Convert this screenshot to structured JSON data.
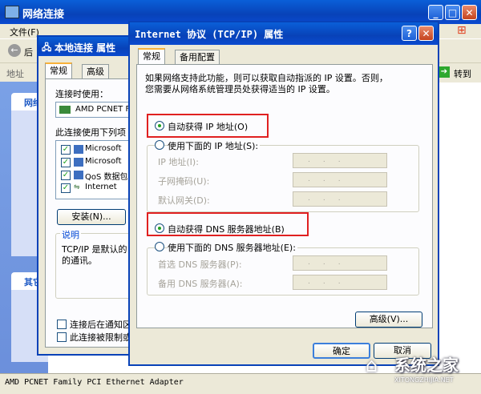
{
  "bg_window": {
    "title": "网络连接",
    "menu": [
      "文件(F)"
    ],
    "back_label": "后",
    "address_label": "地址",
    "go_label": "转到",
    "sidebar_head1": "网络",
    "sidebar_head2": "其它"
  },
  "local_dialog": {
    "title": "本地连接 属性",
    "tabs": [
      "常规",
      "高级"
    ],
    "connect_using": "连接时使用：",
    "adapter_short": "AMD PCNET F",
    "items_label": "此连接使用下列项",
    "items": [
      "Microsoft",
      "Microsoft",
      "QoS 数据包",
      "Internet"
    ],
    "install_button": "安装(N)...",
    "desc_group": "说明",
    "desc_text": "TCP/IP 是默认的广域网协议，它提供在不同的相互连接的网络上的通讯。",
    "desc_line1": "TCP/IP 是默认的",
    "desc_line2": "的通讯。",
    "chk1": "连接后在通知区",
    "chk2": "此连接被限制或"
  },
  "tcp_dialog": {
    "title": "Internet 协议 (TCP/IP) 属性",
    "tabs": [
      "常规",
      "备用配置"
    ],
    "intro1": "如果网络支持此功能，则可以获取自动指派的 IP 设置。否则，",
    "intro2": "您需要从网络系统管理员处获得适当的 IP 设置。",
    "auto_ip": "自动获得 IP 地址(O)",
    "manual_ip": "使用下面的 IP 地址(S):",
    "ip_label": "IP 地址(I):",
    "mask_label": "子网掩码(U):",
    "gateway_label": "默认网关(D):",
    "auto_dns": "自动获得 DNS 服务器地址(B)",
    "manual_dns": "使用下面的 DNS 服务器地址(E):",
    "pref_dns": "首选 DNS 服务器(P):",
    "alt_dns": "备用 DNS 服务器(A):",
    "advanced_button": "高级(V)...",
    "ok_button": "确定",
    "cancel_button": "取消",
    "field_dots": "...",
    "help_glyph": "?",
    "close_glyph": "✕"
  },
  "status_bar": "AMD PCNET Family PCI Ethernet Adapter",
  "watermark": "系统之家",
  "watermark_url": "XITONGZHIJIA.NET"
}
